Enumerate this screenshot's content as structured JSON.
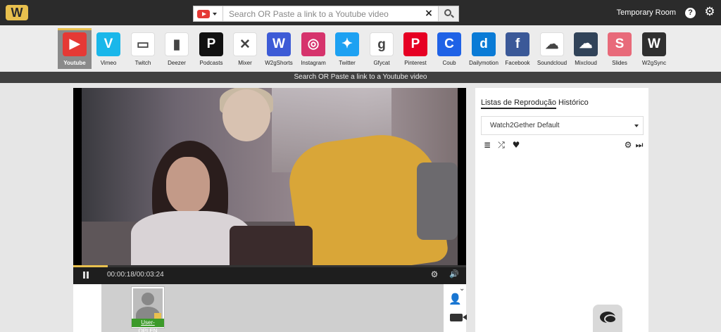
{
  "header": {
    "logo_text": "W",
    "search_placeholder": "Search OR Paste a link to a Youtube video",
    "clear_icon": "×",
    "room_label": "Temporary Room",
    "help_icon": "?",
    "settings_icon": "⚙"
  },
  "providers": [
    {
      "label": "Youtube",
      "color": "#e53935",
      "glyph": "▶",
      "active": true
    },
    {
      "label": "Vimeo",
      "color": "#1ab7ea",
      "glyph": "V"
    },
    {
      "label": "Twitch",
      "color": "#ffffff",
      "glyph": "▭"
    },
    {
      "label": "Deezer",
      "color": "#ffffff",
      "glyph": "▮"
    },
    {
      "label": "Podcasts",
      "color": "#111111",
      "glyph": "P"
    },
    {
      "label": "Mixer",
      "color": "#ffffff",
      "glyph": "✕"
    },
    {
      "label": "W2gShorts",
      "color": "#3d5bd6",
      "glyph": "W"
    },
    {
      "label": "Instagram",
      "color": "#d6336c",
      "glyph": "◎"
    },
    {
      "label": "Twitter",
      "color": "#1da1f2",
      "glyph": "✦"
    },
    {
      "label": "Gfycat",
      "color": "#ffffff",
      "glyph": "g"
    },
    {
      "label": "Pinterest",
      "color": "#e60023",
      "glyph": "P"
    },
    {
      "label": "Coub",
      "color": "#1f62e6",
      "glyph": "C"
    },
    {
      "label": "Dailymotion",
      "color": "#0a7bd6",
      "glyph": "d"
    },
    {
      "label": "Facebook",
      "color": "#3b5998",
      "glyph": "f"
    },
    {
      "label": "Soundcloud",
      "color": "#ffffff",
      "glyph": "☁"
    },
    {
      "label": "Mixcloud",
      "color": "#314359",
      "glyph": "☁"
    },
    {
      "label": "Slides",
      "color": "#e86a7a",
      "glyph": "S"
    },
    {
      "label": "W2gSync",
      "color": "#2f2f2f",
      "glyph": "W"
    }
  ],
  "hint_bar": "Search OR Paste a link to a Youtube video",
  "player": {
    "current_time": "00:00:18",
    "duration": "00:03:24",
    "time_display": "00:00:18/00:03:24",
    "progress_fraction": 0.088
  },
  "users": [
    {
      "name": "User-OPLEN"
    }
  ],
  "panel": {
    "tab_playlists": "Listas de Reprodução",
    "tab_history": "Histórico",
    "playlist_selected": "Watch2Gether Default",
    "tools": [
      {
        "icon": "list-icon",
        "glyph": "≣"
      },
      {
        "icon": "shuffle-icon",
        "glyph": "⤮"
      },
      {
        "icon": "heart-icon",
        "glyph": "♥"
      }
    ],
    "tools_right": [
      {
        "icon": "gear-icon",
        "glyph": "⚙"
      },
      {
        "icon": "skip-icon",
        "glyph": "⏭"
      }
    ]
  },
  "colors": {
    "accent": "#e8c04e",
    "topbar": "#2b2b2b",
    "user_name_bg": "#3c9a2a"
  }
}
